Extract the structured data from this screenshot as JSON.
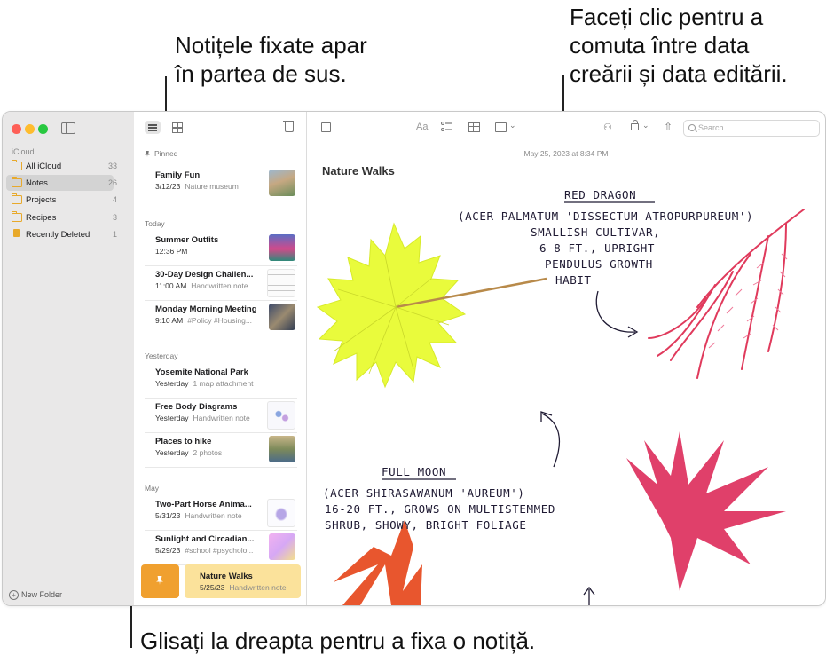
{
  "callouts": {
    "top_left_line1": "Notițele fixate apar",
    "top_left_line2": "în partea de sus.",
    "top_right_line1": "Faceți clic pentru a",
    "top_right_line2": "comuta între data",
    "top_right_line3": "creării și data editării.",
    "bottom": "Glisați la dreapta pentru a fixa o notiță."
  },
  "sidebar": {
    "section": "iCloud",
    "folders": [
      {
        "name": "All iCloud",
        "count": "33",
        "icon": "folder-icon"
      },
      {
        "name": "Notes",
        "count": "26",
        "icon": "folder-icon",
        "selected": true
      },
      {
        "name": "Projects",
        "count": "4",
        "icon": "folder-icon"
      },
      {
        "name": "Recipes",
        "count": "3",
        "icon": "folder-icon"
      },
      {
        "name": "Recently Deleted",
        "count": "1",
        "icon": "trash-icon"
      }
    ],
    "new_folder": "New Folder"
  },
  "note_list": {
    "groups": {
      "pinned": "Pinned",
      "today": "Today",
      "yesterday": "Yesterday",
      "may": "May"
    },
    "notes": [
      {
        "title": "Family Fun",
        "date": "3/12/23",
        "subtitle": "Nature museum"
      },
      {
        "title": "Summer Outfits",
        "date": "12:36 PM",
        "subtitle": ""
      },
      {
        "title": "30-Day Design Challen...",
        "date": "11:00 AM",
        "subtitle": "Handwritten note"
      },
      {
        "title": "Monday Morning Meeting",
        "date": "9:10 AM",
        "subtitle": "#Policy #Housing..."
      },
      {
        "title": "Yosemite National Park",
        "date": "Yesterday",
        "subtitle": "1 map attachment"
      },
      {
        "title": "Free Body Diagrams",
        "date": "Yesterday",
        "subtitle": "Handwritten note"
      },
      {
        "title": "Places to hike",
        "date": "Yesterday",
        "subtitle": "2 photos"
      },
      {
        "title": "Two-Part Horse Anima...",
        "date": "5/31/23",
        "subtitle": "Handwritten note"
      },
      {
        "title": "Sunlight and Circadian...",
        "date": "5/29/23",
        "subtitle": "#school #psycholo..."
      },
      {
        "title": "Nature Walks",
        "date": "5/25/23",
        "subtitle": "Handwritten note"
      }
    ]
  },
  "editor": {
    "aa": "Aa",
    "search_placeholder": "Search",
    "timestamp": "May 25, 2023 at 8:34 PM",
    "title": "Nature Walks",
    "handwriting": {
      "red_dragon_title": "RED DRAGON",
      "red_dragon_lines": [
        "(ACER PALMATUM 'DISSECTUM ATROPURPUREUM')",
        "SMALLISH CULTIVAR,",
        "6-8 FT., UPRIGHT",
        "PENDULUS GROWTH",
        "HABIT"
      ],
      "full_moon_title": "FULL MOON",
      "full_moon_lines": [
        "(ACER SHIRASAWANUM 'AUREUM')",
        "16-20 FT., GROWS ON MULTISTEMMED",
        "SHRUB, SHOWY, BRIGHT FOLIAGE"
      ]
    }
  },
  "colors": {
    "accent": "#f0a02f",
    "swiped_note_bg": "#fbe29b",
    "leaf_yellow": "#e9fb3c",
    "leaf_red": "#e03a5c",
    "folder_icon": "#e8a92a"
  }
}
